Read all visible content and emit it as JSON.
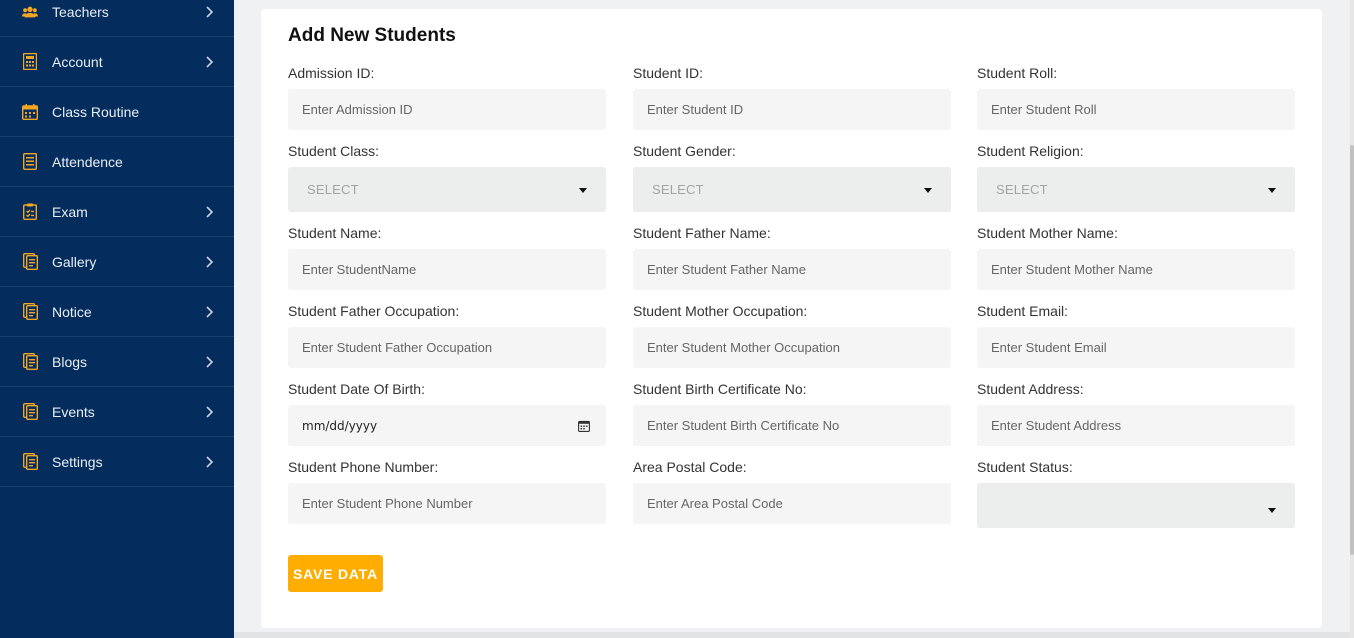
{
  "sidebar": {
    "items": [
      {
        "label": "Teachers",
        "icon": "users-icon",
        "has_submenu": true
      },
      {
        "label": "Account",
        "icon": "calculator-icon",
        "has_submenu": true
      },
      {
        "label": "Class Routine",
        "icon": "calendar-icon",
        "has_submenu": false
      },
      {
        "label": "Attendence",
        "icon": "list-icon",
        "has_submenu": false
      },
      {
        "label": "Exam",
        "icon": "clipboard-icon",
        "has_submenu": true
      },
      {
        "label": "Gallery",
        "icon": "document-icon",
        "has_submenu": true
      },
      {
        "label": "Notice",
        "icon": "document-icon",
        "has_submenu": true
      },
      {
        "label": "Blogs",
        "icon": "document-icon",
        "has_submenu": true
      },
      {
        "label": "Events",
        "icon": "document-icon",
        "has_submenu": true
      },
      {
        "label": "Settings",
        "icon": "document-icon",
        "has_submenu": true
      }
    ]
  },
  "form": {
    "title": "Add New Students",
    "fields": [
      {
        "label": "Admission ID:",
        "placeholder": "Enter Admission ID",
        "type": "text"
      },
      {
        "label": "Student ID:",
        "placeholder": "Enter Student ID",
        "type": "text"
      },
      {
        "label": "Student Roll:",
        "placeholder": "Enter Student Roll",
        "type": "text"
      },
      {
        "label": "Student Class:",
        "value": "SELECT",
        "type": "select"
      },
      {
        "label": "Student Gender:",
        "value": "SELECT",
        "type": "select"
      },
      {
        "label": "Student Religion:",
        "value": "SELECT",
        "type": "select"
      },
      {
        "label": "Student Name:",
        "placeholder": "Enter StudentName",
        "type": "text"
      },
      {
        "label": "Student Father Name:",
        "placeholder": "Enter Student Father Name",
        "type": "text"
      },
      {
        "label": "Student Mother Name:",
        "placeholder": "Enter Student Mother Name",
        "type": "text"
      },
      {
        "label": "Student Father Occupation:",
        "placeholder": "Enter Student Father Occupation",
        "type": "text"
      },
      {
        "label": "Student Mother Occupation:",
        "placeholder": "Enter Student Mother Occupation",
        "type": "text"
      },
      {
        "label": "Student Email:",
        "placeholder": "Enter Student Email",
        "type": "text"
      },
      {
        "label": "Student Date Of Birth:",
        "value": "mm/dd/yyyy",
        "type": "date"
      },
      {
        "label": "Student Birth Certificate No:",
        "placeholder": "Enter Student Birth Certificate No",
        "type": "text"
      },
      {
        "label": "Student Address:",
        "placeholder": "Enter Student Address",
        "type": "text"
      },
      {
        "label": "Student Phone Number:",
        "placeholder": "Enter Student Phone Number",
        "type": "text"
      },
      {
        "label": "Area Postal Code:",
        "placeholder": "Enter Area Postal Code",
        "type": "text"
      },
      {
        "label": "Student Status:",
        "value": "",
        "type": "select"
      }
    ],
    "save_label": "SAVE DATA"
  },
  "colors": {
    "sidebar_bg": "#042c5c",
    "icon_accent": "#f5a623",
    "button_bg": "#ffae01"
  }
}
